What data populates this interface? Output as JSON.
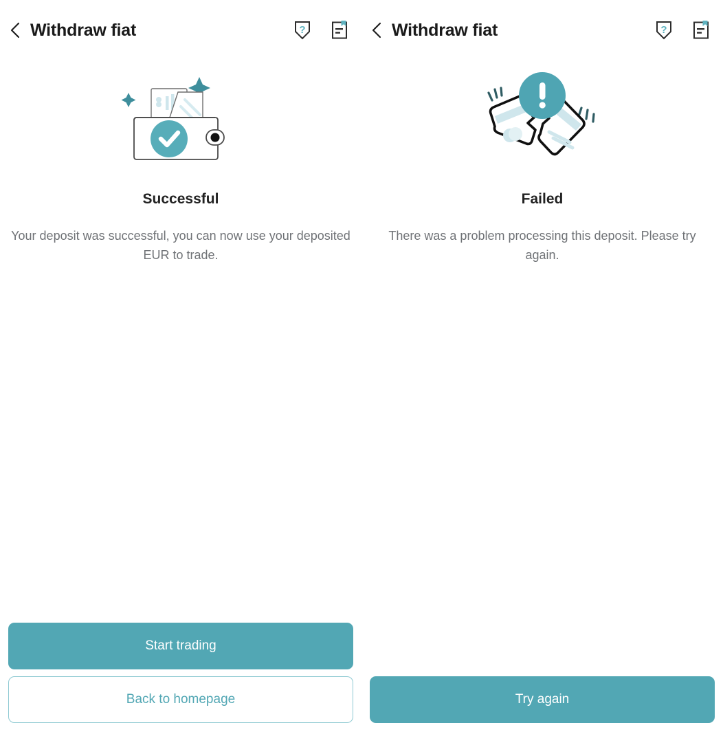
{
  "accent_color": "#52A7B4",
  "accent_light": "#8DC9D2",
  "text_dark": "#222222",
  "text_muted": "#6F7276",
  "panels": [
    {
      "header": {
        "title": "Withdraw fiat",
        "back_icon": "chevron-left-icon",
        "help_icon": "shield-question-icon",
        "doc_icon": "document-bookmark-icon"
      },
      "illustration": "wallet-success-illustration",
      "status_title": "Successful",
      "status_desc": "Your deposit was successful, you can now use your deposited EUR to trade.",
      "buttons": [
        {
          "label": "Start trading",
          "style": "primary",
          "name": "start-trading-button"
        },
        {
          "label": "Back to homepage",
          "style": "outline",
          "name": "back-to-homepage-button"
        }
      ]
    },
    {
      "header": {
        "title": "Withdraw fiat",
        "back_icon": "chevron-left-icon",
        "help_icon": "shield-question-icon",
        "doc_icon": "document-bookmark-icon"
      },
      "illustration": "torn-card-failed-illustration",
      "status_title": "Failed",
      "status_desc": "There was a problem processing this deposit. Please try again.",
      "buttons": [
        {
          "label": "Try again",
          "style": "primary",
          "name": "try-again-button"
        }
      ]
    }
  ]
}
